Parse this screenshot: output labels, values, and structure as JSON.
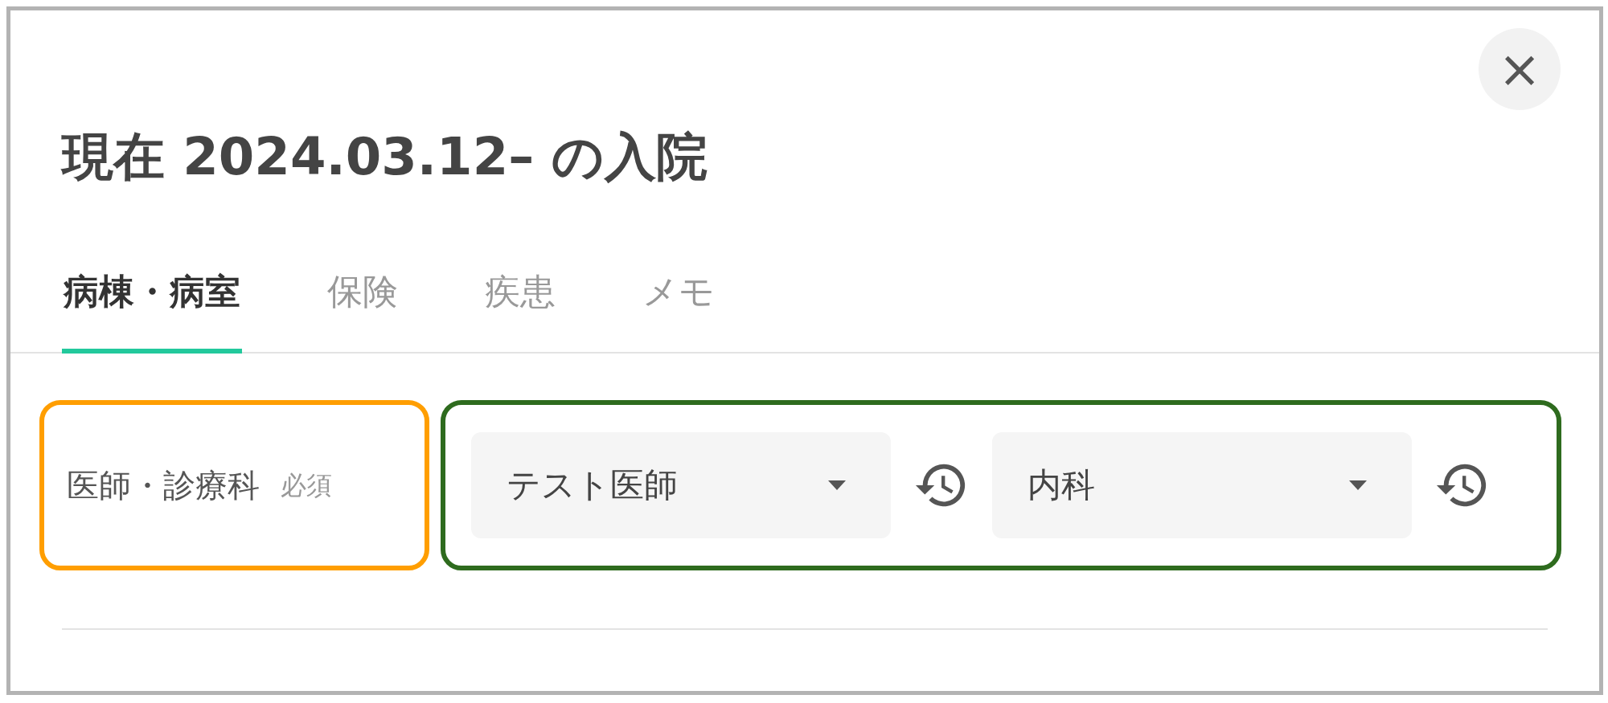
{
  "dialog": {
    "title": "現在 2024.03.12– の入院",
    "close": "×"
  },
  "tabs": [
    {
      "label": "病棟・病室",
      "selected": true
    },
    {
      "label": "保険",
      "selected": false
    },
    {
      "label": "疾患",
      "selected": false
    },
    {
      "label": "メモ",
      "selected": false
    }
  ],
  "field_row": {
    "label": "医師・診療科",
    "required": "必須",
    "highlight_frames": [
      {
        "color": "#ff9e00"
      },
      {
        "color": "#2e6b1e"
      }
    ],
    "selects": [
      {
        "value": "テスト医師"
      },
      {
        "value": "内科"
      }
    ]
  }
}
